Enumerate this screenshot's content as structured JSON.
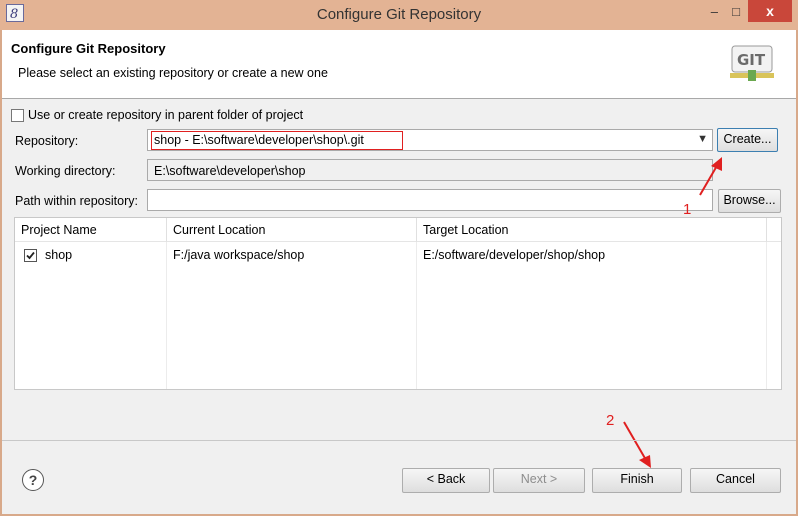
{
  "window": {
    "title": "Configure Git Repository",
    "minimize": "–",
    "maximize": "□",
    "close": "x"
  },
  "banner": {
    "title": "Configure Git Repository",
    "message": "Please select an existing repository or create a new one",
    "logo_text": "GIT"
  },
  "use_parent": {
    "label": "Use or create repository in parent folder of project",
    "checked": false
  },
  "repository": {
    "label": "Repository:",
    "value": "shop - E:\\software\\developer\\shop\\.git",
    "create_button": "Create..."
  },
  "working_directory": {
    "label": "Working directory:",
    "value": "E:\\software\\developer\\shop"
  },
  "path_within": {
    "label": "Path within repository:",
    "value": "",
    "browse_button": "Browse..."
  },
  "table": {
    "columns": [
      "Project Name",
      "Current Location",
      "Target Location"
    ],
    "rows": [
      {
        "checked": true,
        "name": "shop",
        "current": "F:/java workspace/shop",
        "target": "E:/software/developer/shop/shop"
      }
    ]
  },
  "footer": {
    "help": "?",
    "back": "< Back",
    "next": "Next >",
    "finish": "Finish",
    "cancel": "Cancel"
  },
  "annotations": {
    "one": "1",
    "two": "2"
  }
}
